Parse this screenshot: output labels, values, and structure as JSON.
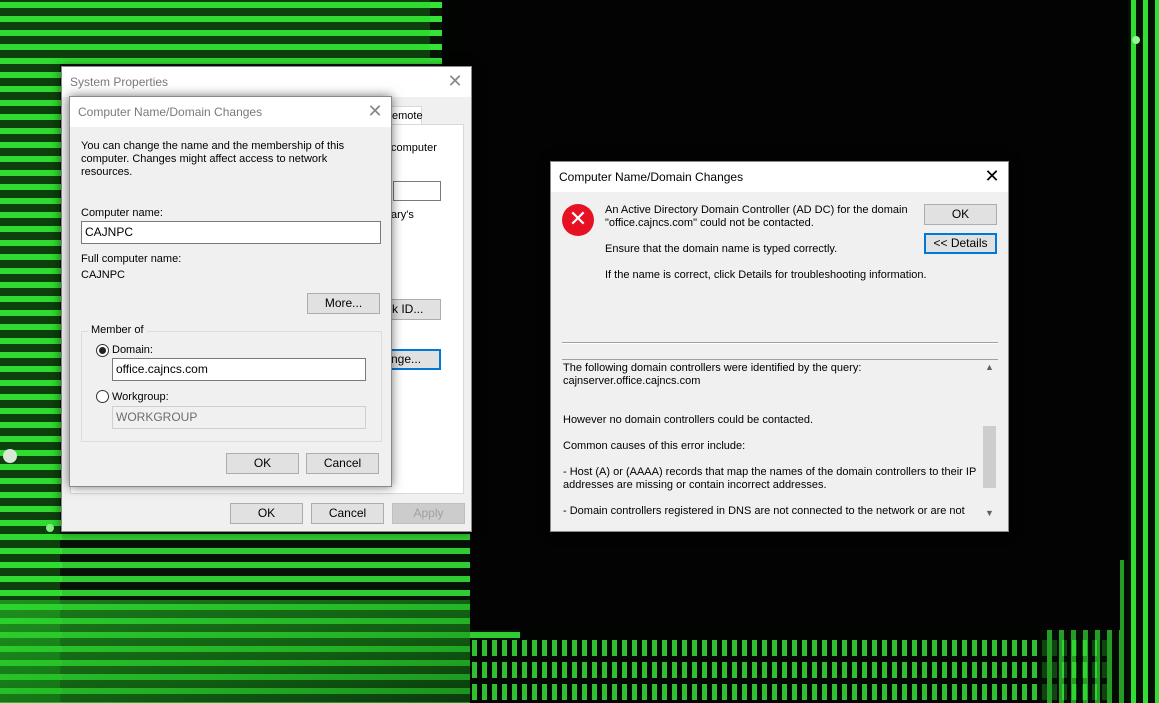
{
  "system_properties": {
    "title": "System Properties",
    "tab_partial": "emote",
    "side_text_1": "computer",
    "side_text_2": "ary's",
    "network_id_partial": "rk ID...",
    "change_partial": "nge...",
    "ok": "OK",
    "cancel": "Cancel",
    "apply": "Apply"
  },
  "name_dialog": {
    "title": "Computer Name/Domain Changes",
    "description": "You can change the name and the membership of this computer. Changes might affect access to network resources.",
    "computer_name_label": "Computer name:",
    "computer_name_value": "CAJNPC",
    "full_name_label": "Full computer name:",
    "full_name_value": "CAJNPC",
    "more_button": "More...",
    "member_of_label": "Member of",
    "domain_label": "Domain:",
    "domain_value": "office.cajncs.com",
    "domain_selected": true,
    "workgroup_label": "Workgroup:",
    "workgroup_value": "WORKGROUP",
    "ok": "OK",
    "cancel": "Cancel"
  },
  "error_dialog": {
    "title": "Computer Name/Domain Changes",
    "message_line1": "An Active Directory Domain Controller (AD DC) for the domain",
    "message_line2": "\"office.cajncs.com\" could not be contacted.",
    "message_hint": "Ensure that the domain name is typed correctly.",
    "message_details_hint": "If the name is correct, click Details for troubleshooting information.",
    "ok": "OK",
    "details_button": "<< Details",
    "details_lines": [
      "The following domain controllers were identified by the query:",
      "cajnserver.office.cajncs.com",
      "",
      "",
      "However no domain controllers could be contacted.",
      "",
      "Common causes of this error include:",
      "",
      "- Host (A) or (AAAA) records that map the names of the domain controllers to their IP",
      "addresses are missing or contain incorrect addresses.",
      "",
      "- Domain controllers registered in DNS are not connected to the network or are not"
    ],
    "icon": "error-x-icon",
    "icon_color": "#e81123"
  },
  "colors": {
    "focus_blue": "#0078d7",
    "circuit_green": "#39ff3a"
  }
}
